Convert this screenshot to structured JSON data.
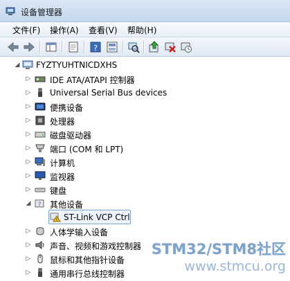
{
  "window": {
    "title": "设备管理器"
  },
  "menu": [
    "文件(F)",
    "操作(A)",
    "查看(V)",
    "帮助(H)"
  ],
  "toolbar": {
    "buttons": [
      "back-icon",
      "forward-icon",
      "show-hide-console-tree-icon",
      "properties-icon",
      "help-icon",
      "view-icon",
      "scan-hardware-icon",
      "update-driver-icon",
      "uninstall-icon",
      "disable-icon"
    ]
  },
  "tree": {
    "root": "FYZTYUHTNICDXHS",
    "items": [
      {
        "label": "IDE ATA/ATAPI 控制器",
        "icon": "ide-controller-icon"
      },
      {
        "label": "Universal Serial Bus devices",
        "icon": "usb-icon"
      },
      {
        "label": "便携设备",
        "icon": "portable-device-icon"
      },
      {
        "label": "处理器",
        "icon": "processor-icon"
      },
      {
        "label": "磁盘驱动器",
        "icon": "disk-drive-icon"
      },
      {
        "label": "端口 (COM 和 LPT)",
        "icon": "port-icon"
      },
      {
        "label": "计算机",
        "icon": "computer-icon"
      },
      {
        "label": "监视器",
        "icon": "monitor-icon"
      },
      {
        "label": "键盘",
        "icon": "keyboard-icon"
      },
      {
        "label": "其他设备",
        "icon": "other-devices-icon",
        "expanded": true
      },
      {
        "label": "人体学输入设备",
        "icon": "hid-icon"
      },
      {
        "label": "声音、视频和游戏控制器",
        "icon": "sound-icon"
      },
      {
        "label": "鼠标和其他指针设备",
        "icon": "mouse-icon"
      },
      {
        "label": "通用串行总线控制器",
        "icon": "usb-controller-icon"
      }
    ],
    "child": {
      "label": "ST-Link VCP Ctrl",
      "icon": "warning-device-icon"
    }
  },
  "watermark": {
    "line1": "STM32/STM8社区",
    "line2": "www.stmcu.org"
  },
  "colors": {
    "selection": "#eef4fb",
    "selection_border": "#7da2ce",
    "watermark": "#7fa2c8"
  }
}
